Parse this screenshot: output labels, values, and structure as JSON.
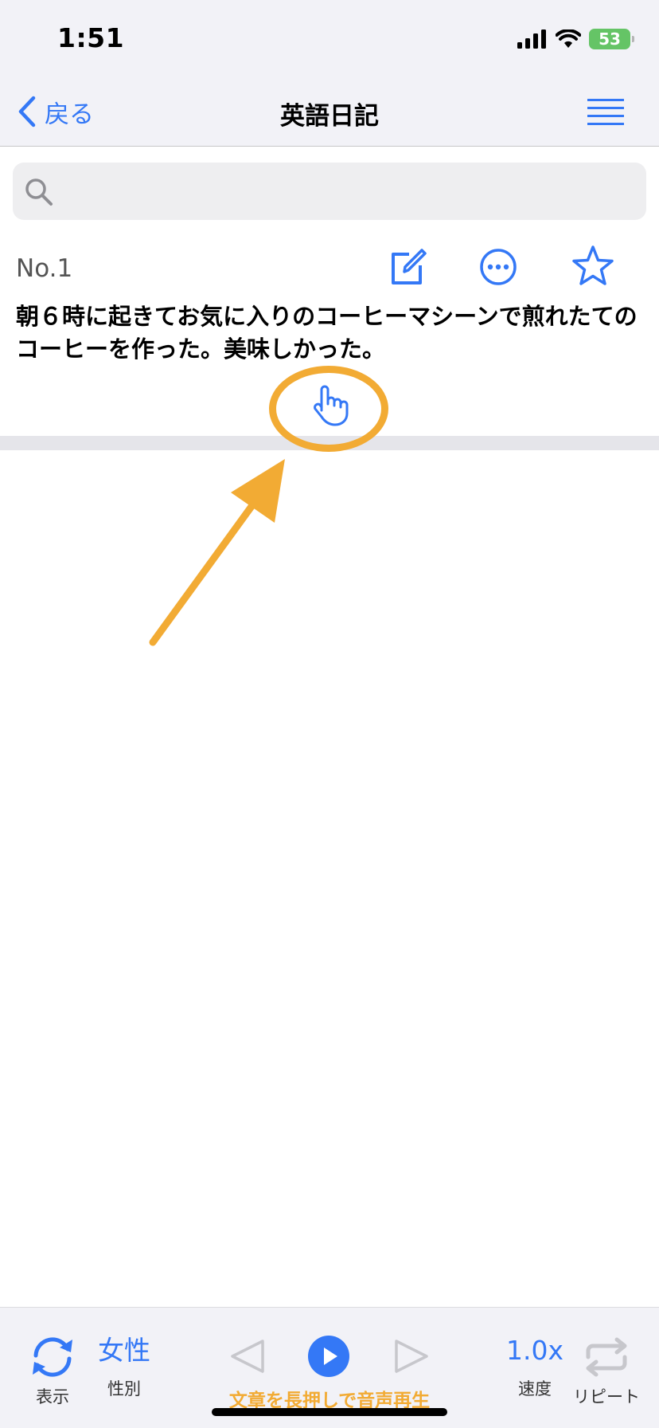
{
  "status_bar": {
    "time": "1:51",
    "battery": "53"
  },
  "nav": {
    "back_label": "戻る",
    "title": "英語日記"
  },
  "search": {
    "placeholder": ""
  },
  "entry": {
    "number": "No.1",
    "text": "朝６時に起きてお気に入りのコーヒーマシーンで煎れたてのコーヒーを作った。美味しかった。"
  },
  "toolbar": {
    "display_label": "表示",
    "gender_value": "女性",
    "gender_label": "性別",
    "speed_value": "1.0x",
    "speed_label": "速度",
    "repeat_label": "リピート",
    "hint": "文章を長押しで音声再生"
  },
  "colors": {
    "accent": "#3478f6",
    "annotation": "#f2ab34",
    "battery": "#65c466"
  },
  "icons": [
    "signal-icon",
    "wifi-icon",
    "battery-icon",
    "chevron-left-icon",
    "hamburger-menu-icon",
    "search-icon",
    "edit-icon",
    "more-icon",
    "star-icon",
    "tap-hand-icon",
    "refresh-icon",
    "prev-icon",
    "play-icon",
    "next-icon",
    "repeat-icon"
  ]
}
